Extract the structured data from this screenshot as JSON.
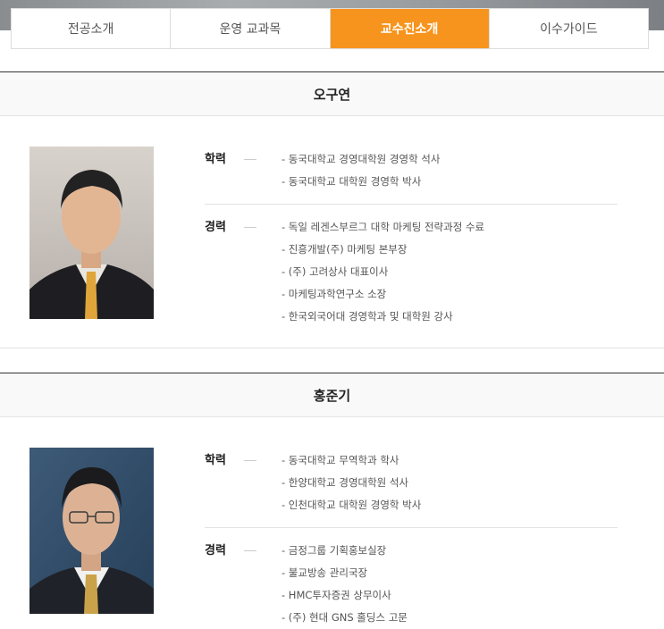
{
  "tabs": [
    {
      "label": "전공소개",
      "active": false
    },
    {
      "label": "운영 교과목",
      "active": false
    },
    {
      "label": "교수진소개",
      "active": true
    },
    {
      "label": "이수가이드",
      "active": false
    }
  ],
  "accent_color": "#f7941d",
  "professors": [
    {
      "name": "오구연",
      "education_label": "학력",
      "education": [
        "- 동국대학교 경영대학원 경영학 석사",
        "- 동국대학교 대학원 경영학 박사"
      ],
      "career_label": "경력",
      "career": [
        "- 독일 레겐스부르그 대학 마케팅 전략과정 수료",
        "- 진흥개발(주) 마케팅 본부장",
        "- (주) 고려상사 대표이사",
        "- 마케팅과학연구소 소장",
        "- 한국외국어대 경영학과 및 대학원 강사"
      ]
    },
    {
      "name": "홍준기",
      "education_label": "학력",
      "education": [
        "- 동국대학교 무역학과 학사",
        "- 한양대학교 경영대학원 석사",
        "- 인천대학교 대학원 경영학 박사"
      ],
      "career_label": "경력",
      "career": [
        "- 금정그룹 기획홍보실장",
        "- 불교방송 관리국장",
        "- HMC투자증권 상무이사",
        "- (주) 현대 GNS 홀딩스 고문"
      ]
    }
  ]
}
